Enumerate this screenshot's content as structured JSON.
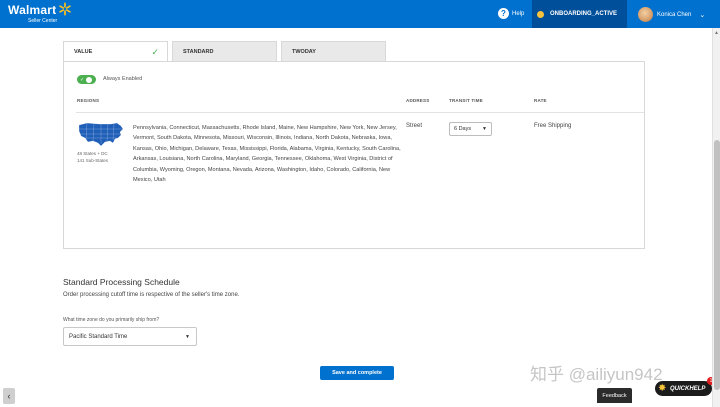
{
  "header": {
    "logo": "Walmart",
    "logo_sub": "Seller Center",
    "help_label": "Help",
    "status_label": "ONBOARDING_ACTIVE",
    "user_name": "Konica Chen",
    "brand_color": "#0071ce",
    "status_color": "#f8c33c"
  },
  "tabs": [
    {
      "label": "VALUE",
      "active": true
    },
    {
      "label": "STANDARD",
      "active": false
    },
    {
      "label": "TWODAY",
      "active": false
    }
  ],
  "panel": {
    "always_enabled": "Always Enabled",
    "columns": {
      "regions": "REGIONS",
      "address": "ADDRESS",
      "transit": "TRANSIT TIME",
      "rate": "RATE"
    },
    "map_caption_line1": "48 States + DC",
    "map_caption_line2": "141 Sub-States",
    "regions_text": "Pennsylvania, Connecticut, Massachusetts, Rhode Island, Maine, New Hampshire, New York, New Jersey, Vermont, South Dakota, Minnesota, Missouri, Wisconsin, Illinois, Indiana, North Dakota, Nebraska, Iowa, Kansas, Ohio, Michigan, Delaware, Texas, Mississippi, Florida, Alabama, Virginia, Kentucky, South Carolina, Arkansas, Louisiana, North Carolina, Maryland, Georgia, Tennessee, Oklahoma, West Virginia, District of Columbia, Wyoming, Oregon, Montana, Nevada, Arizona, Washington, Idaho, Colorado, California, New Mexico, Utah",
    "address_value": "Street",
    "transit_value": "6 Days",
    "rate_value": "Free Shipping"
  },
  "schedule": {
    "title": "Standard Processing Schedule",
    "description": "Order processing cutoff time is respective of the seller's time zone.",
    "tz_label": "What time zone do you primarily ship from?",
    "tz_value": "Pacific Standard Time"
  },
  "actions": {
    "save_label": "Save and complete"
  },
  "overlay": {
    "watermark": "知乎 @ailiyun942",
    "quickhelp_label": "QUICKHELP",
    "quickhelp_badge": "1",
    "feedback_label": "Feedback"
  }
}
